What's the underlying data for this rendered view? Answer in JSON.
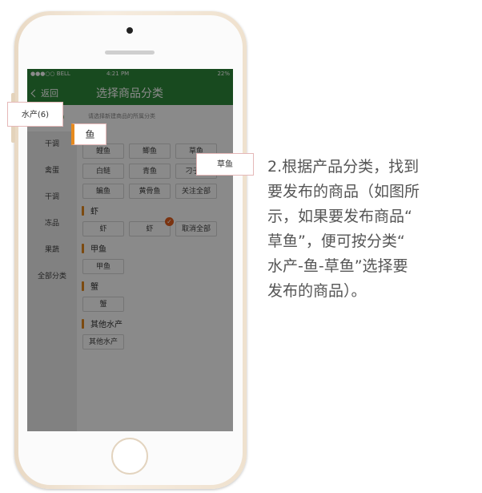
{
  "status_bar": {
    "carrier": "●●●○○ BELL",
    "time": "4:21 PM",
    "battery": "22%"
  },
  "nav": {
    "back_label": "返回",
    "title": "选择商品分类"
  },
  "sidebar": {
    "items": [
      {
        "label": "水产(6)"
      },
      {
        "label": "干调"
      },
      {
        "label": "禽蛋"
      },
      {
        "label": "干调"
      },
      {
        "label": "冻品"
      },
      {
        "label": "果蔬"
      },
      {
        "label": "全部分类"
      }
    ]
  },
  "content": {
    "hint": "请选择新建商品的所属分类",
    "sections": [
      {
        "title": "鱼",
        "chips": [
          "鲤鱼",
          "鲫鱼",
          "草鱼",
          "白鲢",
          "青鱼",
          "刁子鱼",
          "鳊鱼",
          "黄骨鱼",
          "关注全部"
        ]
      },
      {
        "title": "虾",
        "chips": [
          "虾",
          "虾",
          "取消全部"
        ]
      },
      {
        "title": "甲鱼",
        "chips": [
          "甲鱼"
        ]
      },
      {
        "title": "蟹",
        "chips": [
          "蟹"
        ]
      },
      {
        "title": "其他水产",
        "chips": [
          "其他水产"
        ]
      }
    ]
  },
  "callouts": {
    "category": "水产(6)",
    "fish": "鱼",
    "grass_carp": "草鱼"
  },
  "description": {
    "lines": [
      "2.根据产品分类，找到",
      "要发布的商品（如图所",
      "示，如果要发布商品“",
      "草鱼”，便可按分类“",
      "水产-鱼-草鱼”选择要",
      "发布的商品）。"
    ]
  },
  "colors": {
    "brand_green": "#2e8a3a",
    "accent_orange": "#e68a1e",
    "check_red": "#e35f1f"
  }
}
